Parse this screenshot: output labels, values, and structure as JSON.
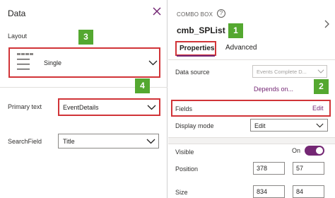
{
  "left_pane": {
    "title": "Data",
    "layout": {
      "label": "Layout",
      "value": "Single"
    },
    "primary_text": {
      "label": "Primary text",
      "value": "EventDetails"
    },
    "search_field": {
      "label": "SearchField",
      "value": "Title"
    }
  },
  "right_pane": {
    "section_caption": "COMBO BOX",
    "help_glyph": "?",
    "control_name": "cmb_SPList",
    "tabs": [
      {
        "label": "Properties",
        "selected": true
      },
      {
        "label": "Advanced",
        "selected": false
      }
    ],
    "data_source": {
      "label": "Data source",
      "value": "Events Complete D..."
    },
    "depends_on": "Depends on...",
    "fields": {
      "label": "Fields",
      "action": "Edit"
    },
    "display_mode": {
      "label": "Display mode",
      "value": "Edit"
    },
    "visible": {
      "label": "Visible",
      "state_text": "On",
      "on": true
    },
    "position": {
      "label": "Position",
      "x": "378",
      "y": "57"
    },
    "size": {
      "label": "Size",
      "width": "834",
      "height": "84"
    }
  },
  "annotations": {
    "badges": [
      "1",
      "2",
      "3",
      "4"
    ],
    "badge_color": "#54a830",
    "highlight_color": "#d13438"
  },
  "colors": {
    "accent": "#742774"
  },
  "icons": [
    "close-icon",
    "chevron-down-icon",
    "help-icon",
    "chevron-right-icon",
    "single-layout-icon"
  ]
}
